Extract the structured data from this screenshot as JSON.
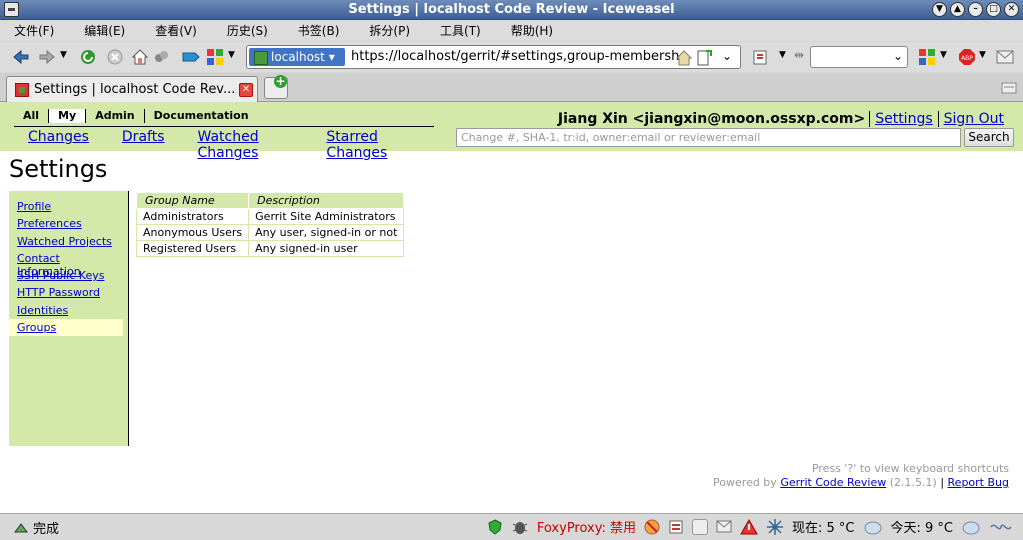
{
  "window": {
    "title": "Settings | localhost Code Review - Iceweasel"
  },
  "menu": {
    "items": [
      "文件(F)",
      "编辑(E)",
      "查看(V)",
      "历史(S)",
      "书签(B)",
      "拆分(P)",
      "工具(T)",
      "帮助(H)"
    ]
  },
  "nav": {
    "identity": "localhost",
    "url": "https://localhost/gerrit/#settings,group-membersh"
  },
  "tab": {
    "title": "Settings | localhost Code Rev..."
  },
  "gerrit": {
    "top_tabs": [
      "All",
      "My",
      "Admin",
      "Documentation"
    ],
    "sub_tabs": [
      "Changes",
      "Drafts",
      "Watched Changes",
      "Starred Changes"
    ],
    "user": "Jiang Xin <jiangxin@moon.ossxp.com>",
    "settings_link": "Settings",
    "signout_link": "Sign Out",
    "search_placeholder": "Change #, SHA-1, tr:id, owner:email or reviewer:email",
    "search_button": "Search",
    "page_title": "Settings",
    "side_menu": [
      "Profile",
      "Preferences",
      "Watched Projects",
      "Contact Information",
      "SSH Public Keys",
      "HTTP Password",
      "Identities",
      "Groups"
    ],
    "table": {
      "headers": [
        "Group Name",
        "Description"
      ],
      "rows": [
        [
          "Administrators",
          "Gerrit Site Administrators"
        ],
        [
          "Anonymous Users",
          "Any user, signed-in or not"
        ],
        [
          "Registered Users",
          "Any signed-in user"
        ]
      ]
    },
    "footer": {
      "shortcuts": "Press '?' to view keyboard shortcuts",
      "powered": "Powered by",
      "product_link": "Gerrit Code Review",
      "version": "(2.1.5.1)",
      "sep": "|",
      "report_link": "Report Bug"
    }
  },
  "status": {
    "left": "完成",
    "proxy": "FoxyProxy: 禁用",
    "weather_now": "现在: 5 °C",
    "weather_today": "今天: 9 °C"
  }
}
